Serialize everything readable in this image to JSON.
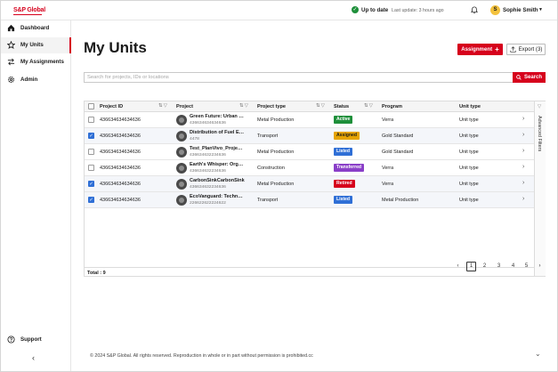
{
  "brand": {
    "logo_text": "S&P Global"
  },
  "topbar": {
    "status_label": "Up to date",
    "last_update": "Last update: 3 hours ago",
    "user_initial": "S",
    "user_name": "Sophie Smith",
    "icons": [
      "check-circle-icon",
      "bell-icon",
      "chevron-down-icon"
    ]
  },
  "sidebar": {
    "items": [
      {
        "label": "Dashboard",
        "icon": "home-icon"
      },
      {
        "label": "My Units",
        "icon": "star-icon",
        "active": true
      },
      {
        "label": "My Assignments",
        "icon": "swap-arrows-icon"
      },
      {
        "label": "Admin",
        "icon": "gear-icon"
      }
    ],
    "support_label": "Support",
    "collapse_icon": "chevron-left-icon"
  },
  "page": {
    "title": "My Units",
    "assignment_label": "Assignment",
    "assignment_icon": "plus-icon",
    "export_label": "Export (3)",
    "export_icon": "upload-icon"
  },
  "search": {
    "placeholder": "Search for projects, IDs or locations",
    "button_label": "Search",
    "icon": "search-icon"
  },
  "table": {
    "columns": [
      "Project ID",
      "Project",
      "Project type",
      "Status",
      "Program",
      "Unit type"
    ],
    "rows": [
      {
        "selected": false,
        "project_id": "436634634634636",
        "project_name": "Green Future: Urban an...",
        "project_sub": "436634634634636",
        "project_type": "Metal Production",
        "status": "Active",
        "status_color": "#1e8f3a",
        "program": "Verra",
        "unit_type": "Unit type"
      },
      {
        "selected": true,
        "project_id": "436634634634636",
        "project_name": "Distribution of Fuel Efficie...",
        "project_sub": "4478",
        "project_type": "Transport",
        "status": "Assigned",
        "status_color": "#e6a400",
        "program": "Gold Standard",
        "unit_type": "Unit type"
      },
      {
        "selected": false,
        "project_id": "436634634634636",
        "project_name": "Test_PlanVivo_Project_2",
        "project_sub": "436634632234636",
        "project_type": "Metal Production",
        "status": "Listed",
        "status_color": "#2f6fd6",
        "program": "Gold Standard",
        "unit_type": "Unit type"
      },
      {
        "selected": false,
        "project_id": "436634634634636",
        "project_name": "Earth's Whisper: Organ...",
        "project_sub": "436634632234636",
        "project_type": "Construction",
        "status": "Transferred",
        "status_color": "#8a3fc8",
        "program": "Verra",
        "unit_type": "Unit type"
      },
      {
        "selected": true,
        "project_id": "436634634634636",
        "project_name": "CarbonSinkCarbonSink",
        "project_sub": "436634632234636",
        "project_type": "Metal Production",
        "status": "Retired",
        "status_color": "#d6001c",
        "program": "Verra",
        "unit_type": "Unit type"
      },
      {
        "selected": true,
        "project_id": "436634634634636",
        "project_name": "EcoVanguard: Technolo...",
        "project_sub": "226622622224622",
        "project_type": "Transport",
        "status": "Listed",
        "status_color": "#2f6fd6",
        "program": "Metal Production",
        "unit_type": "Unit type"
      }
    ],
    "total_label": "Total : 9",
    "advanced_filters_label": "Advanced Filters"
  },
  "pagination": {
    "pages": [
      "1",
      "2",
      "3",
      "4",
      "5"
    ],
    "current": "1"
  },
  "footer": {
    "text": "© 2024 S&P Global. All rights reserved. Reproduction in whole or in part without permission is prohibited.cc"
  }
}
